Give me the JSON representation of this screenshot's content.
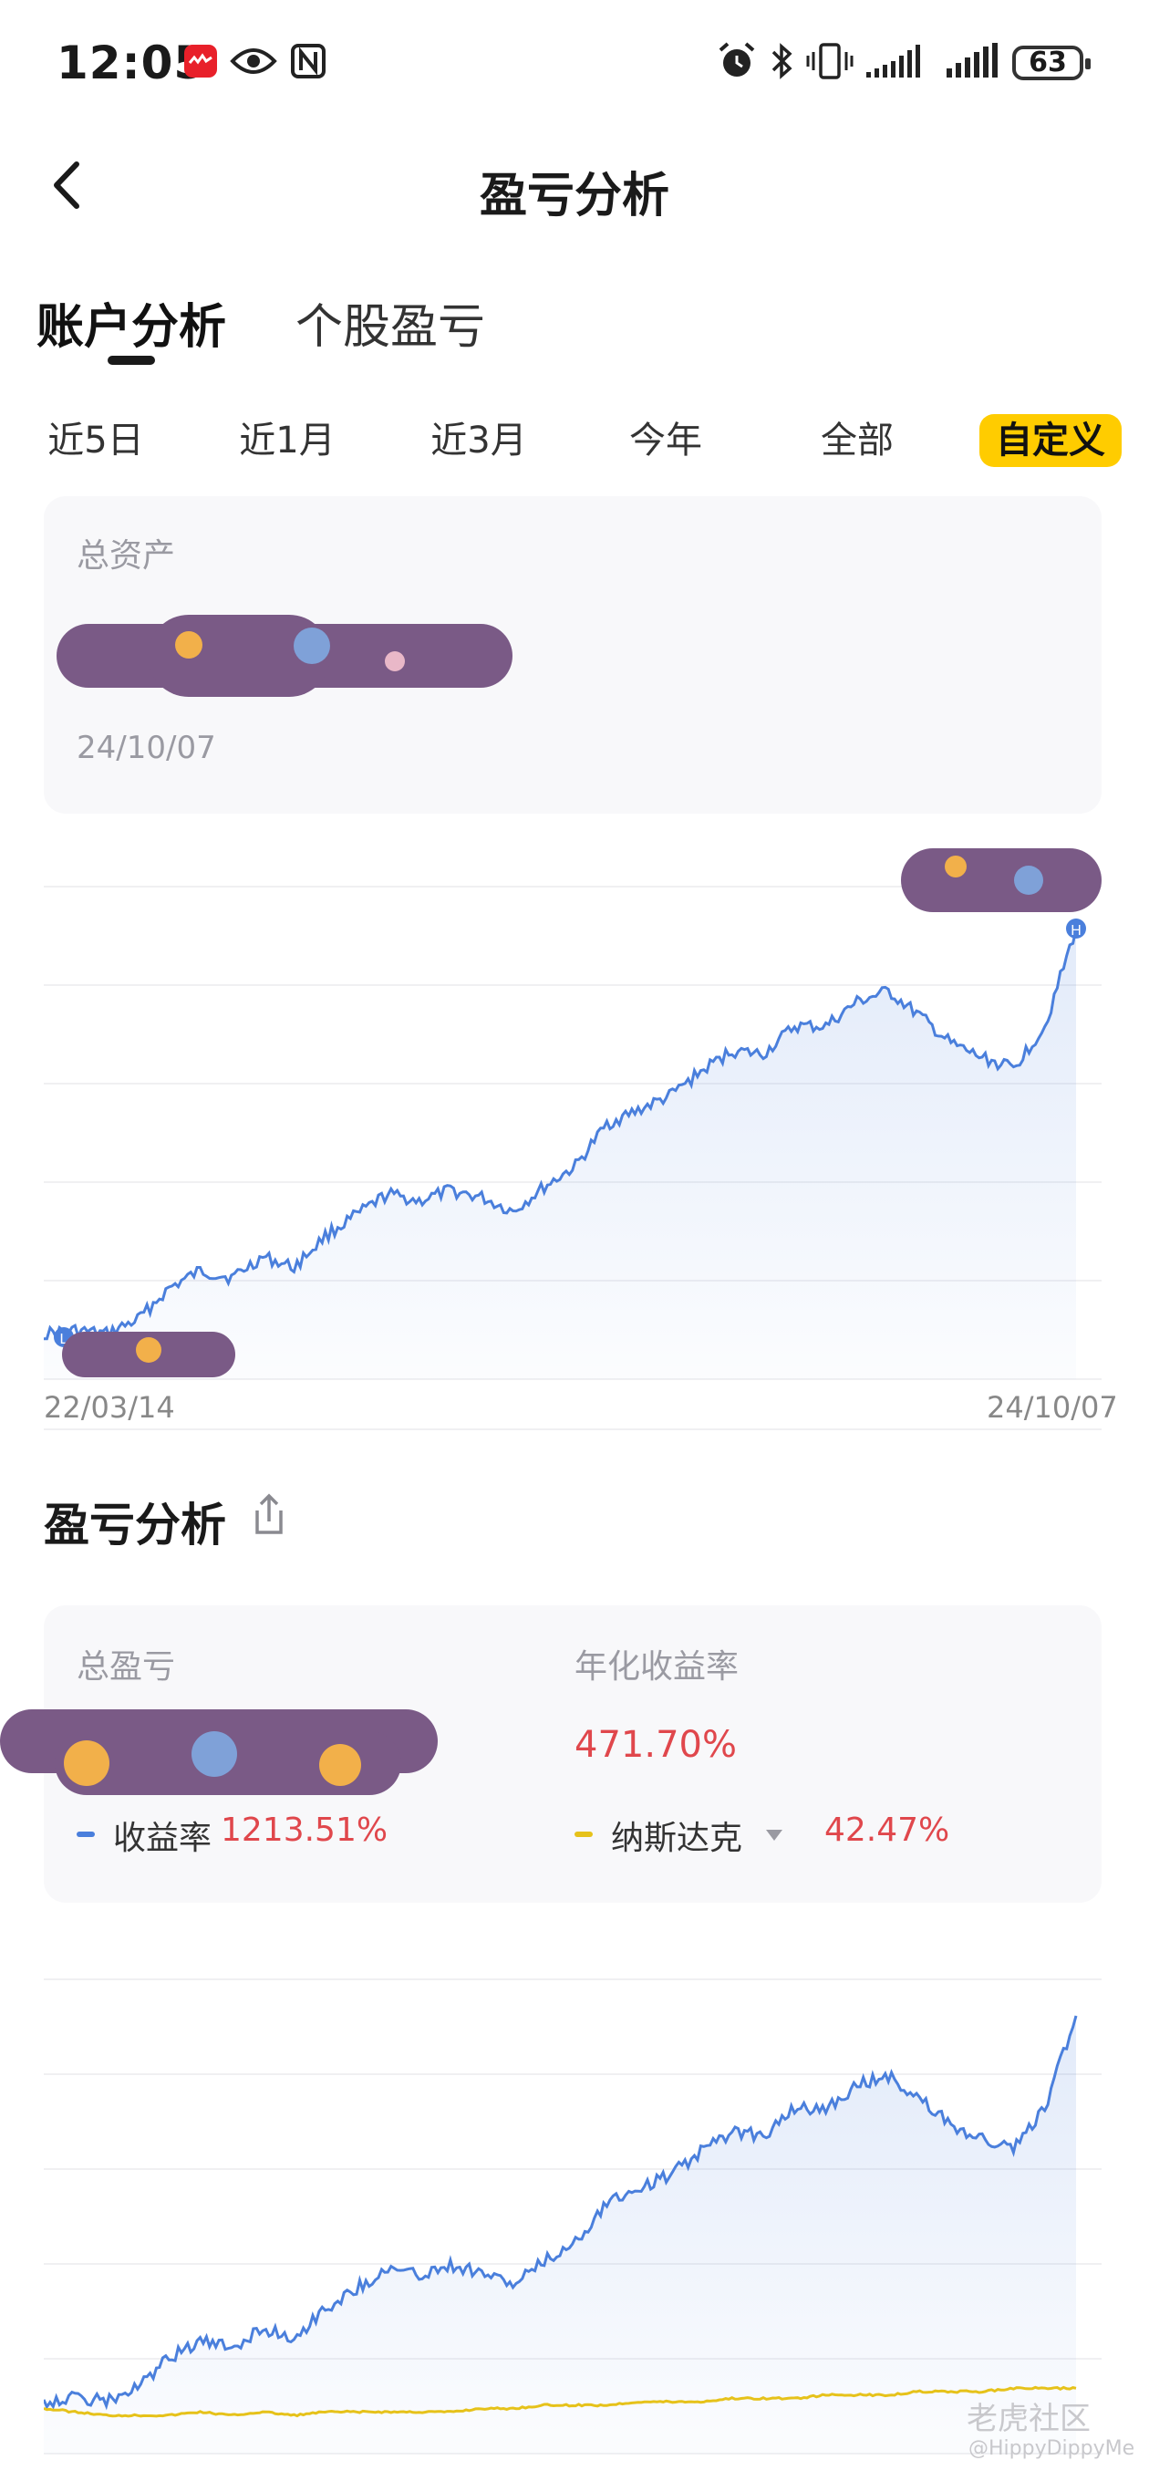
{
  "status_bar": {
    "time": "12:05",
    "battery": "63",
    "icons": [
      "app-badge-icon",
      "eye-icon",
      "nfc-icon",
      "alarm-icon",
      "bluetooth-icon",
      "vibrate-icon",
      "signal-icon",
      "signal-icon",
      "battery-icon"
    ]
  },
  "header": {
    "title": "盈亏分析",
    "back_icon": "chevron-left-icon"
  },
  "tabs": [
    {
      "label": "账户分析",
      "active": true
    },
    {
      "label": "个股盈亏",
      "active": false
    }
  ],
  "ranges": [
    {
      "label": "近5日"
    },
    {
      "label": "近1月"
    },
    {
      "label": "近3月"
    },
    {
      "label": "今年"
    },
    {
      "label": "全部"
    },
    {
      "label": "自定义",
      "active": true
    }
  ],
  "asset_card": {
    "label": "总资产",
    "date": "24/10/07"
  },
  "asset_chart": {
    "start_date": "22/03/14",
    "end_date": "24/10/07",
    "high_marker": "H",
    "low_marker": "L"
  },
  "pnl_section": {
    "title": "盈亏分析",
    "share_icon": "share-icon",
    "total_pnl_label": "总盈亏",
    "annualized_label": "年化收益率",
    "annualized_value": "471.70%",
    "return_label": "收益率",
    "return_value": "1213.51%",
    "benchmark_label": "纳斯达克",
    "benchmark_value": "42.47%"
  },
  "watermark": {
    "brand": "老虎社区",
    "user": "@HippyDippyMe"
  },
  "colors": {
    "accent_yellow": "#ffcc00",
    "line_blue": "#4a7fdc",
    "benchmark_yellow": "#e6c21a",
    "profit_red": "#e0474c"
  },
  "chart_data": [
    {
      "type": "area",
      "series": [
        {
          "x_start": "22/03/14",
          "x_end": "24/10/07",
          "values": [
            0.02,
            0.03,
            0.02,
            0.06,
            0.15,
            0.2,
            0.18,
            0.24,
            0.21,
            0.3,
            0.36,
            0.42,
            0.4,
            0.43,
            0.41,
            0.37,
            0.44,
            0.5,
            0.62,
            0.66,
            0.7,
            0.77,
            0.83,
            0.82,
            0.9,
            0.9,
            0.97,
            1.0,
            0.93,
            0.85,
            0.81,
            0.78,
            0.9,
            1.18
          ]
        }
      ]
    },
    {
      "type": "line",
      "series": [
        {
          "name": "收益率",
          "values": [
            0.02,
            0.03,
            0.02,
            0.06,
            0.15,
            0.2,
            0.18,
            0.24,
            0.21,
            0.3,
            0.36,
            0.42,
            0.4,
            0.43,
            0.41,
            0.37,
            0.44,
            0.5,
            0.62,
            0.66,
            0.7,
            0.77,
            0.83,
            0.82,
            0.9,
            0.9,
            0.97,
            1.0,
            0.93,
            0.85,
            0.81,
            0.78,
            0.9,
            1.18
          ]
        },
        {
          "name": "纳斯达克",
          "values": [
            0.02,
            0.01,
            0.0,
            0.0,
            0.0,
            0.01,
            0.0,
            0.01,
            0.0,
            0.01,
            0.01,
            0.01,
            0.01,
            0.01,
            0.02,
            0.02,
            0.03,
            0.03,
            0.03,
            0.04,
            0.04,
            0.04,
            0.05,
            0.05,
            0.05,
            0.06,
            0.06,
            0.06,
            0.07,
            0.07,
            0.07,
            0.08,
            0.08,
            0.08
          ]
        }
      ]
    }
  ]
}
